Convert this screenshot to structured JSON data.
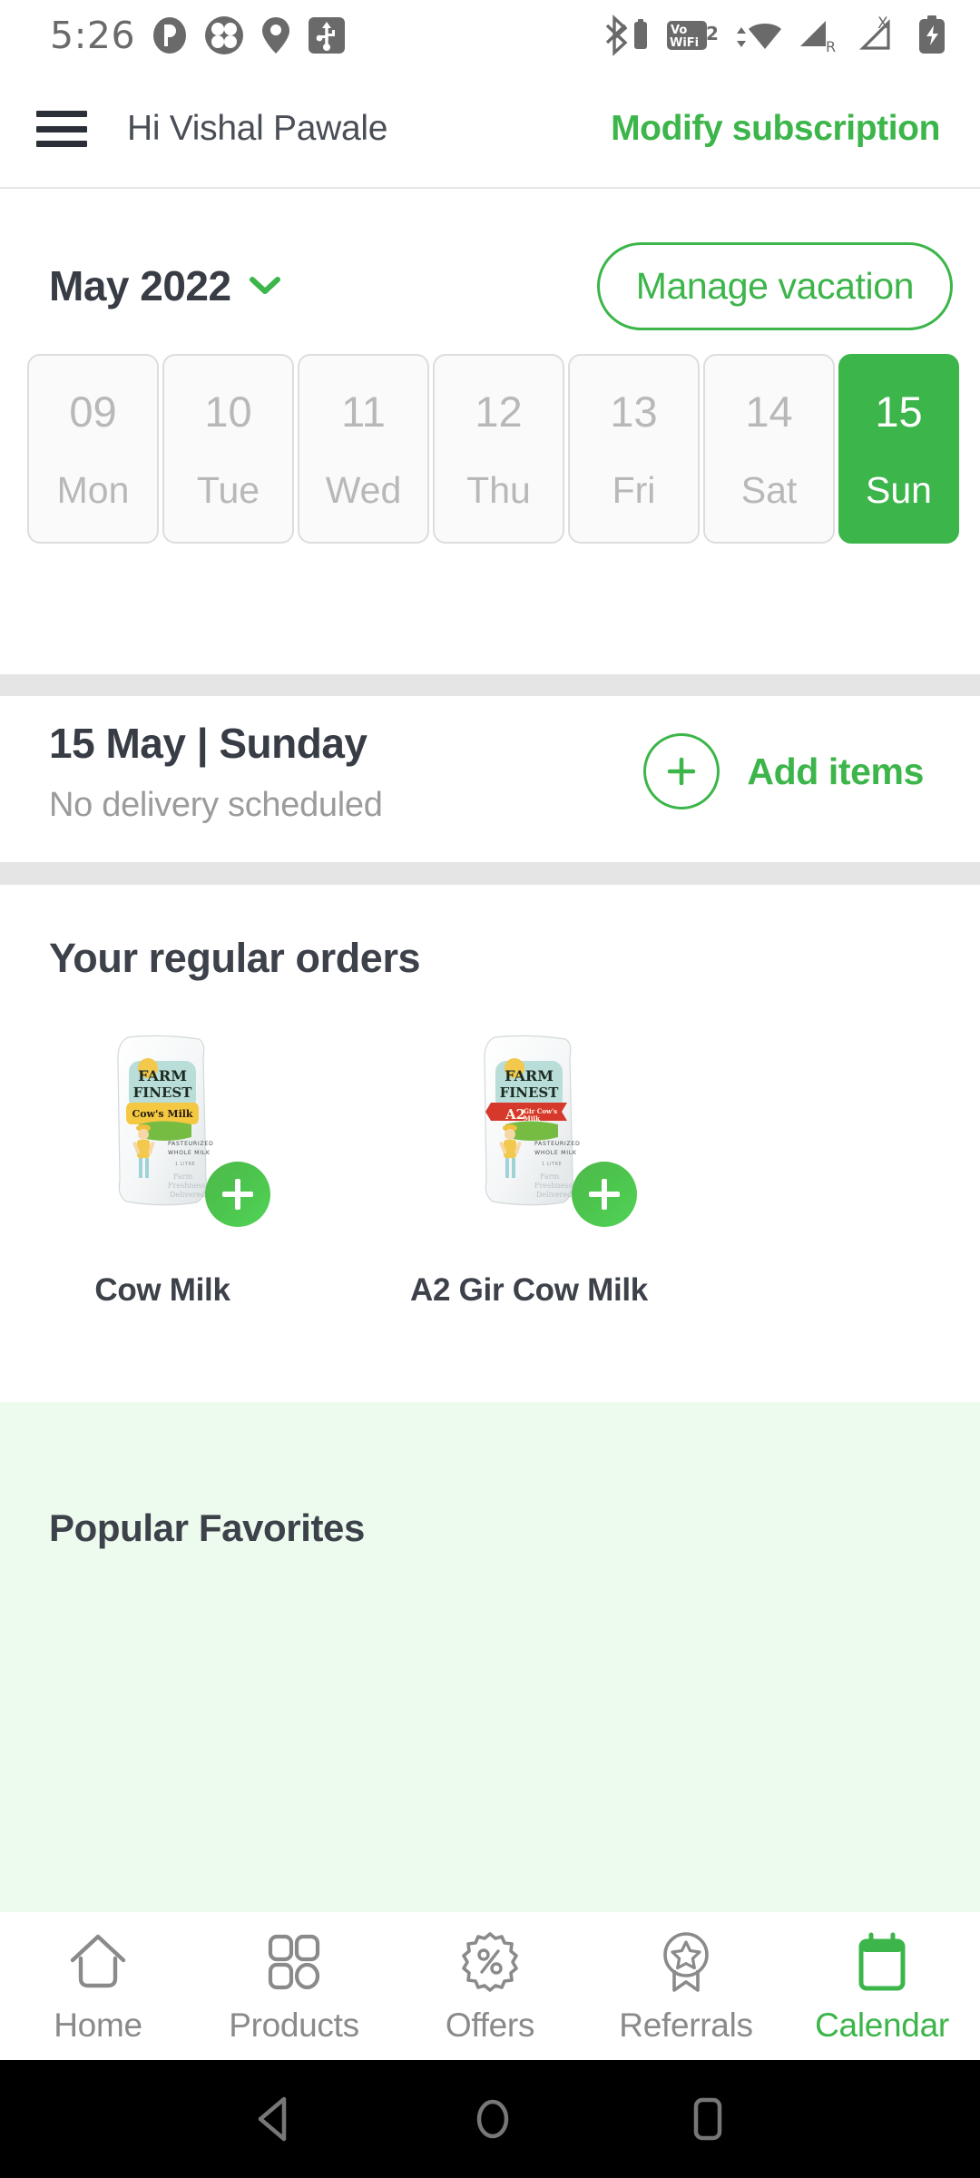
{
  "status_bar": {
    "time": "5:26",
    "left_icons": [
      "do-not-disturb-icon",
      "flower-clover-icon",
      "location-pin-icon",
      "usb-icon"
    ],
    "right_icons": [
      "bluetooth-battery-icon",
      "volte-wifi2-icon",
      "wifi-icon",
      "signal-roaming-icon",
      "signal-no-sim-icon",
      "battery-charging-icon"
    ]
  },
  "header": {
    "menu_icon": "hamburger-menu-icon",
    "greeting": "Hi Vishal Pawale",
    "modify_subscription": "Modify subscription"
  },
  "month_row": {
    "month": "May 2022",
    "dropdown_icon": "chevron-down-icon",
    "manage_vacation": "Manage vacation"
  },
  "date_strip": {
    "days": [
      {
        "num": "09",
        "day": "Mon",
        "selected": false
      },
      {
        "num": "10",
        "day": "Tue",
        "selected": false
      },
      {
        "num": "11",
        "day": "Wed",
        "selected": false
      },
      {
        "num": "12",
        "day": "Thu",
        "selected": false
      },
      {
        "num": "13",
        "day": "Fri",
        "selected": false
      },
      {
        "num": "14",
        "day": "Sat",
        "selected": false
      },
      {
        "num": "15",
        "day": "Sun",
        "selected": true
      }
    ]
  },
  "delivery": {
    "date_title": "15 May |  Sunday",
    "status": "No delivery scheduled",
    "add_items_label": "Add items",
    "add_icon": "plus-circle-icon"
  },
  "regular_orders": {
    "title": "Your regular orders",
    "items": [
      {
        "name": "Cow Milk",
        "brand_line1": "FARM",
        "brand_line2": "FINEST",
        "variant": "Cow's Milk",
        "sub1": "PASTEURIZED",
        "sub2": "WHOLE MILK",
        "size": "1 LITRE",
        "tag1": "Farm",
        "tag2": "Freshness",
        "tag3": "Delivered",
        "banner_color": "#f5c842",
        "add_icon": "plus-circle-icon"
      },
      {
        "name": "A2 Gir Cow Milk",
        "brand_line1": "FARM",
        "brand_line2": "FINEST",
        "variant": "A2",
        "variant_sub1": "Gir Cow's",
        "variant_sub2": "Milk",
        "sub1": "PASTEURIZED",
        "sub2": "WHOLE MILK",
        "size": "1 LITRE",
        "tag1": "Farm",
        "tag2": "Freshness",
        "tag3": "Delivered",
        "banner_color": "#d6392b",
        "add_icon": "plus-circle-icon"
      }
    ]
  },
  "favorites": {
    "title": "Popular Favorites"
  },
  "bottom_nav": {
    "items": [
      {
        "label": "Home",
        "icon": "home-icon",
        "active": false
      },
      {
        "label": "Products",
        "icon": "grid-products-icon",
        "active": false
      },
      {
        "label": "Offers",
        "icon": "percent-badge-icon",
        "active": false
      },
      {
        "label": "Referrals",
        "icon": "star-ribbon-icon",
        "active": false
      },
      {
        "label": "Calendar",
        "icon": "calendar-icon",
        "active": true
      }
    ]
  },
  "android_nav": {
    "back": "back-triangle-icon",
    "home": "home-circle-icon",
    "recents": "recents-square-icon"
  },
  "colors": {
    "accent_green": "#3cb54a",
    "favorites_bg": "#edfbee",
    "divider_gray": "#e5e5e5",
    "text_dark": "#373c45",
    "text_muted": "#9b9b9b"
  }
}
